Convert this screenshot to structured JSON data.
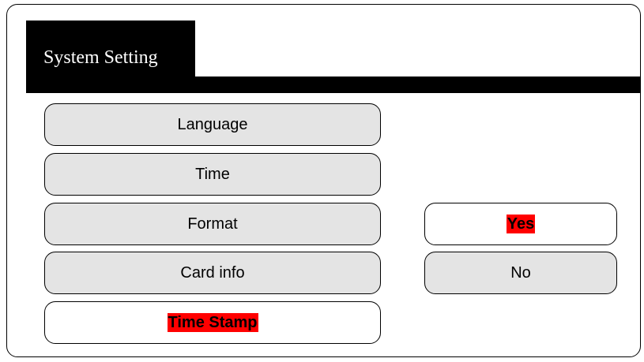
{
  "header": {
    "title": "System Setting"
  },
  "menu": {
    "items": [
      {
        "label": "Language"
      },
      {
        "label": "Time"
      },
      {
        "label": "Format"
      },
      {
        "label": "Card info"
      },
      {
        "label": "Time Stamp"
      }
    ]
  },
  "options": {
    "items": [
      {
        "label": "Yes"
      },
      {
        "label": "No"
      }
    ]
  },
  "colors": {
    "highlight": "#ff0000",
    "button_fill": "#e4e4e4",
    "selected_fill": "#ffffff",
    "header_fill": "#000000"
  }
}
